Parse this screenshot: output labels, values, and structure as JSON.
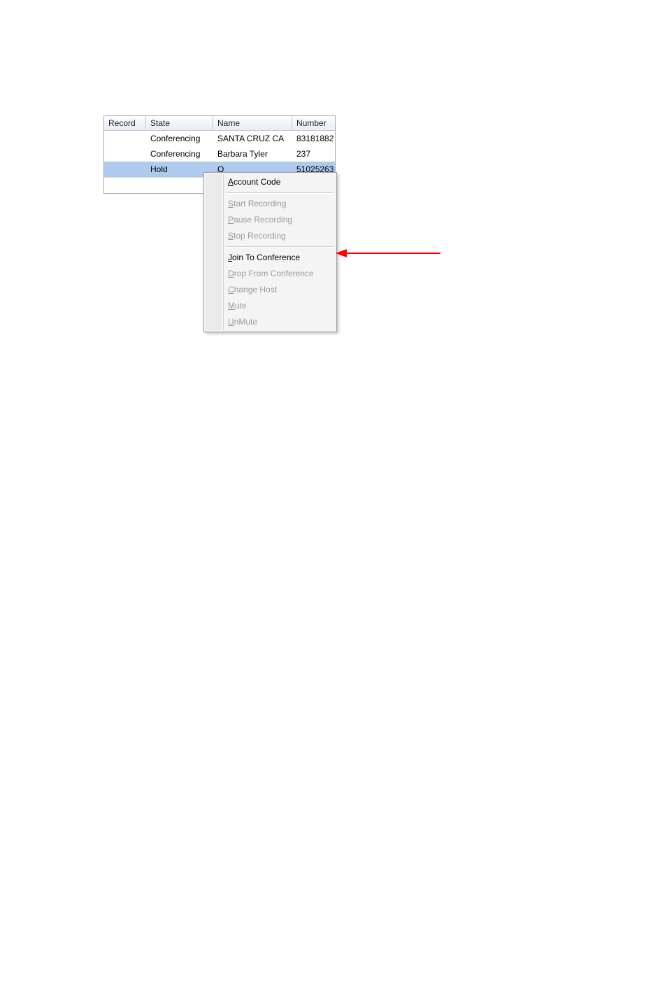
{
  "grid": {
    "headers": {
      "record": "Record",
      "state": "State",
      "name": "Name",
      "number": "Number"
    },
    "rows": [
      {
        "record": "",
        "state": "Conferencing",
        "name": "SANTA CRUZ  CA",
        "number": "83181882"
      },
      {
        "record": "",
        "state": "Conferencing",
        "name": "Barbara Tyler",
        "number": "237"
      },
      {
        "record": "",
        "state": "Hold",
        "name": "O",
        "number": "51025263",
        "selected": true
      }
    ]
  },
  "context_menu": {
    "items": {
      "account_code": {
        "label": "ccount Code",
        "mnemonic": "A",
        "disabled": false
      },
      "start_recording": {
        "label": "tart Recording",
        "mnemonic": "S",
        "disabled": true
      },
      "pause_recording": {
        "label": "ause Recording",
        "mnemonic": "P",
        "disabled": true
      },
      "stop_recording": {
        "label": "top Recording",
        "mnemonic": "S",
        "disabled": true
      },
      "join_to_conference": {
        "label": "oin To Conference",
        "mnemonic": "J",
        "disabled": false
      },
      "drop_from_conference": {
        "label": "rop From Conference",
        "mnemonic": "D",
        "disabled": true
      },
      "change_host": {
        "label": "hange Host",
        "mnemonic": "C",
        "disabled": true
      },
      "mute": {
        "label": "ute",
        "mnemonic": "M",
        "disabled": true
      },
      "unmute": {
        "label": "nMute",
        "mnemonic": "U",
        "disabled": true
      }
    }
  },
  "annotation": {
    "arrow_color": "#ff0000"
  }
}
